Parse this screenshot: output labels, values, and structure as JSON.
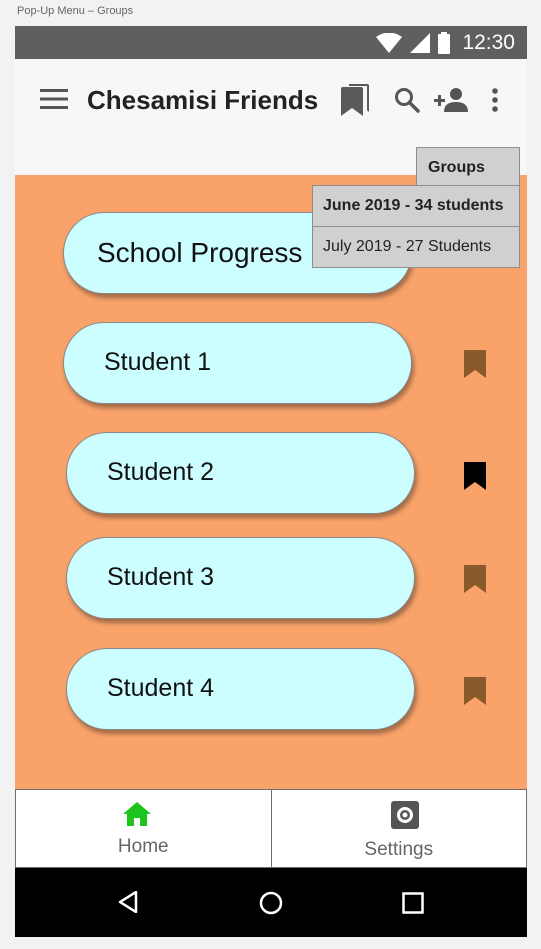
{
  "frame_title": "Pop-Up Menu – Groups",
  "status_bar": {
    "time": "12:30"
  },
  "app_bar": {
    "title": "Chesamisi Friends",
    "icons": [
      "menu-icon",
      "bookmarks-icon",
      "search-icon",
      "add-person-icon",
      "more-vert-icon"
    ]
  },
  "dropdown": {
    "header": "Groups",
    "items": [
      "June 2019 - 34 students",
      "July 2019 - 27 Students"
    ]
  },
  "list": {
    "items": [
      {
        "label": "School Progress",
        "bookmark": "none"
      },
      {
        "label": "Student 1",
        "bookmark": "brown"
      },
      {
        "label": "Student 2",
        "bookmark": "black"
      },
      {
        "label": "Student 3",
        "bookmark": "brown"
      },
      {
        "label": "Student 4",
        "bookmark": "brown"
      }
    ]
  },
  "bottom_nav": {
    "tabs": [
      {
        "label": "Home",
        "icon": "home-icon",
        "active": true
      },
      {
        "label": "Settings",
        "icon": "settings-icon",
        "active": false
      }
    ]
  },
  "colors": {
    "background": "#f9a36b",
    "pill": "#ccfdff",
    "bookmark_brown": "#8b5a2b",
    "bookmark_active": "#000000",
    "home_active": "#1ec41e",
    "status_bar": "#5f5f5f"
  },
  "system_nav": [
    "back-icon",
    "home-circle-icon",
    "recents-icon"
  ]
}
